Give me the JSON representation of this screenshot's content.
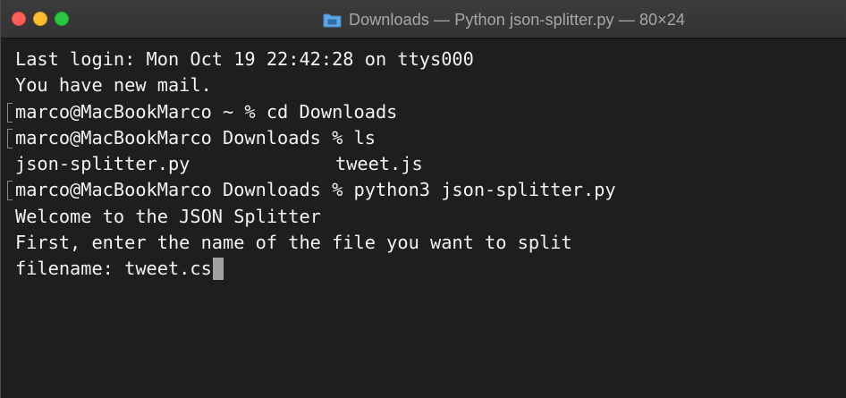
{
  "window": {
    "title": "Downloads — Python json-splitter.py — 80×24",
    "folder_icon": "folder-icon",
    "colors": {
      "close": "#fe5f57",
      "minimize": "#febc2e",
      "zoom": "#28c840",
      "background": "#1e1e1e",
      "text": "#f2f2f2"
    }
  },
  "terminal": {
    "lines": [
      "Last login: Mon Oct 19 22:42:28 on ttys000",
      "You have new mail.",
      "marco@MacBookMarco ~ % cd Downloads",
      "marco@MacBookMarco Downloads % ls",
      "json-splitter.py",
      "Welcome to the JSON Splitter",
      "First, enter the name of the file you want to split",
      "filename: tweet.cs"
    ],
    "ls_second_column": "tweet.js",
    "python_command_line": "marco@MacBookMarco Downloads % python3 json-splitter.py"
  }
}
